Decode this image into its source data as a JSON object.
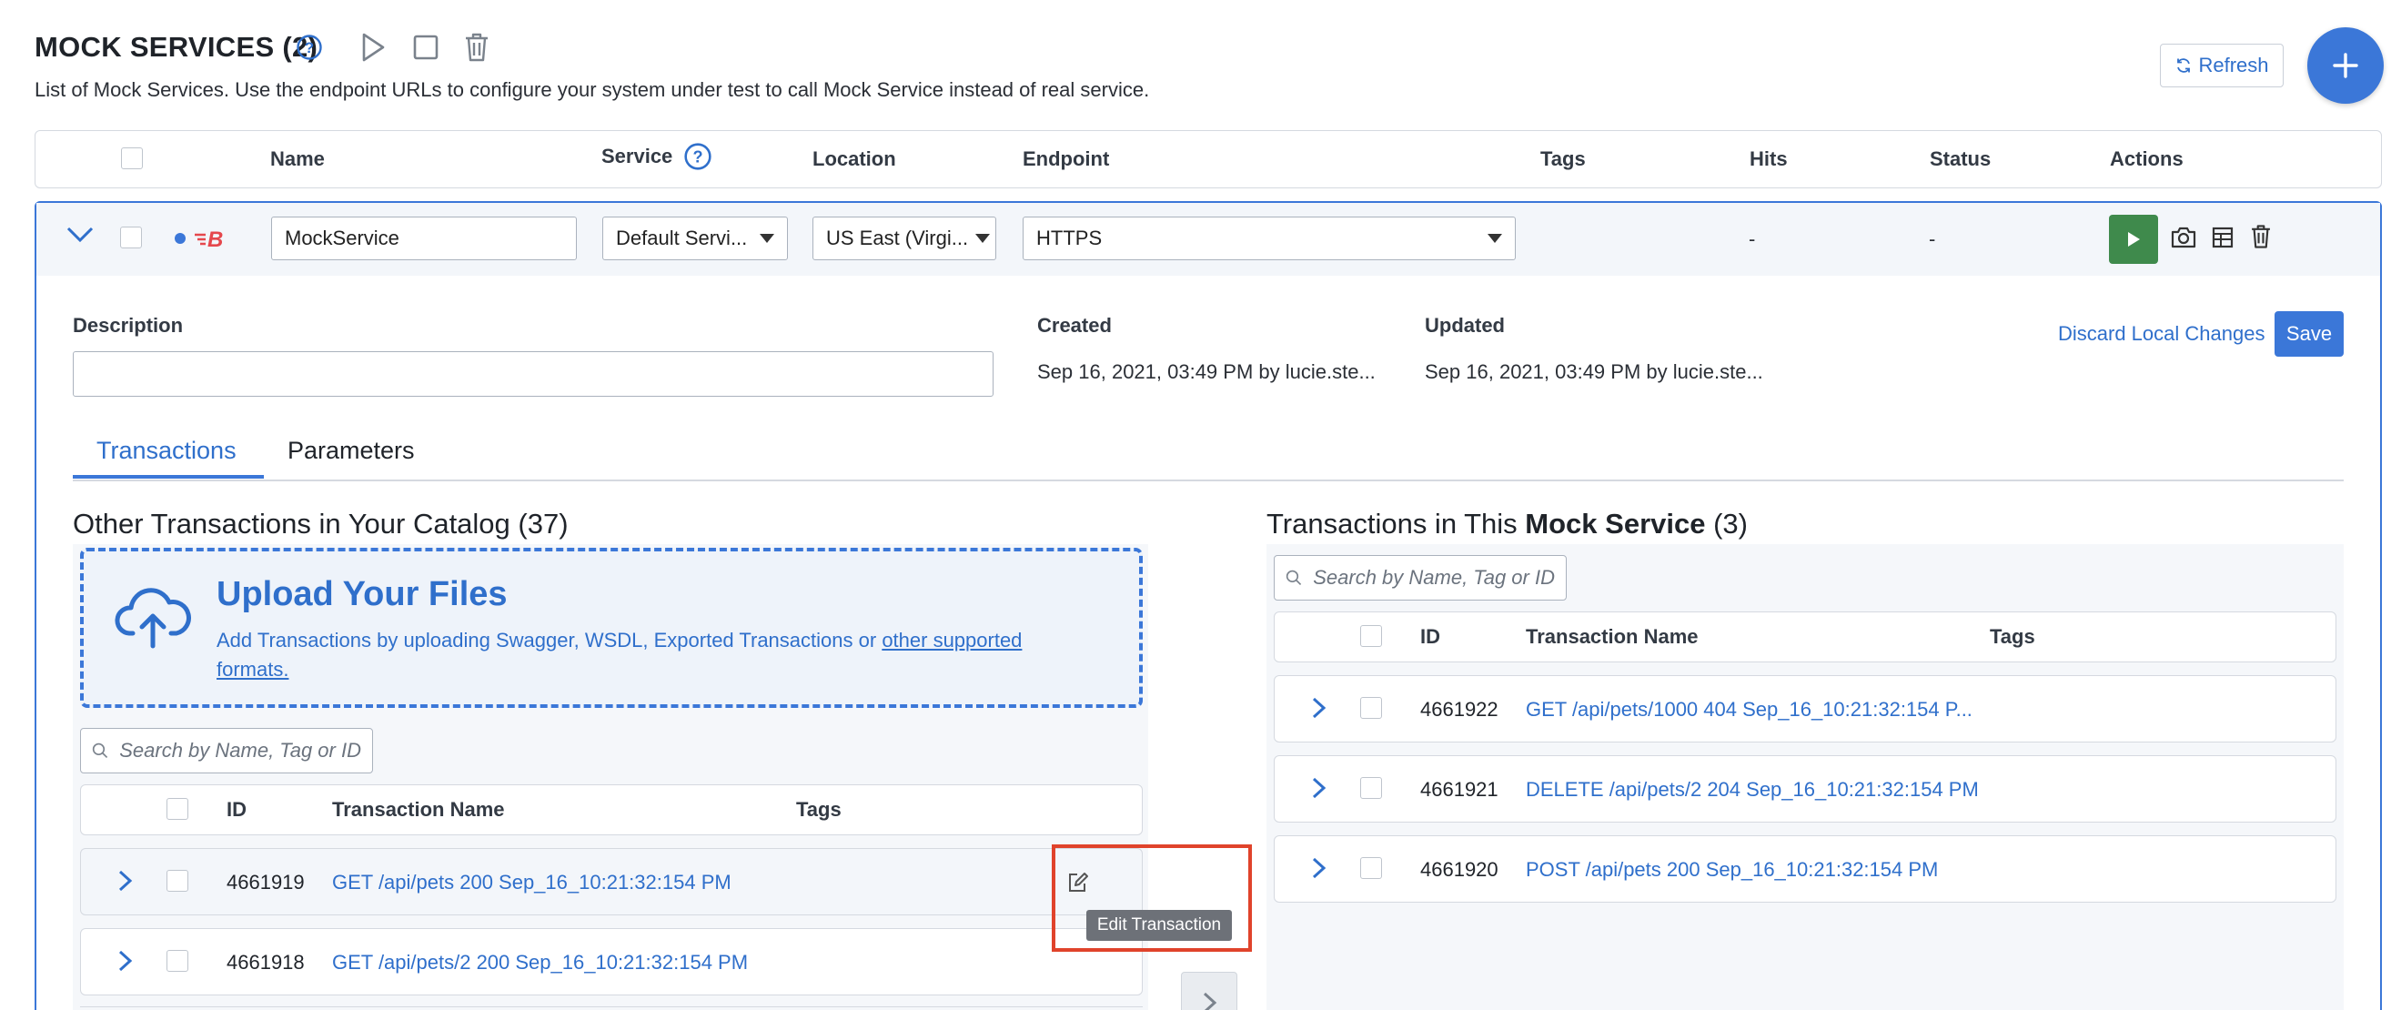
{
  "header": {
    "title": "MOCK SERVICES (2)",
    "subtitle": "List of Mock Services. Use the endpoint URLs to configure your system under test to call Mock Service instead of real service.",
    "refresh_label": "Refresh"
  },
  "table_header": {
    "name": "Name",
    "service": "Service",
    "location": "Location",
    "endpoint": "Endpoint",
    "tags": "Tags",
    "hits": "Hits",
    "status": "Status",
    "actions": "Actions"
  },
  "mock_service": {
    "name_value": "MockService",
    "service_value": "Default Servi...",
    "location_value": "US East (Virgi...",
    "endpoint_value": "HTTPS",
    "hits": "-",
    "status": "-",
    "description_label": "Description",
    "description_value": "",
    "created_label": "Created",
    "created_value": "Sep 16, 2021, 03:49 PM by lucie.ste...",
    "updated_label": "Updated",
    "updated_value": "Sep 16, 2021, 03:49 PM by lucie.ste...",
    "discard_label": "Discard Local Changes",
    "save_label": "Save"
  },
  "tabs": [
    {
      "label": "Transactions",
      "active": true
    },
    {
      "label": "Parameters",
      "active": false
    }
  ],
  "catalog": {
    "title": "Other Transactions in Your Catalog (37)",
    "upload_title": "Upload Your Files",
    "upload_text": "Add Transactions by uploading Swagger, WSDL, Exported Transactions or",
    "upload_link_1": "other supported",
    "upload_link_2": "formats.",
    "search_placeholder": "Search by Name, Tag or ID",
    "columns": {
      "id": "ID",
      "name": "Transaction Name",
      "tags": "Tags"
    },
    "rows": [
      {
        "id": "4661919",
        "name": "GET /api/pets 200 Sep_16_10:21:32:154 PM"
      },
      {
        "id": "4661918",
        "name": "GET /api/pets/2 200 Sep_16_10:21:32:154 PM"
      }
    ],
    "edit_tooltip": "Edit Transaction"
  },
  "service_tx": {
    "title_prefix": "Transactions in This",
    "title_bold": "Mock Service",
    "title_suffix": "(3)",
    "search_placeholder": "Search by Name, Tag or ID",
    "columns": {
      "id": "ID",
      "name": "Transaction Name",
      "tags": "Tags"
    },
    "rows": [
      {
        "id": "4661922",
        "name": "GET /api/pets/1000 404 Sep_16_10:21:32:154 P..."
      },
      {
        "id": "4661921",
        "name": "DELETE /api/pets/2 204 Sep_16_10:21:32:154 PM"
      },
      {
        "id": "4661920",
        "name": "POST /api/pets 200 Sep_16_10:21:32:154 PM"
      }
    ]
  },
  "colors": {
    "accent": "#3b77d8",
    "link": "#2f6fcb",
    "run_green": "#3f8a4c",
    "highlight_red": "#e0432b"
  }
}
